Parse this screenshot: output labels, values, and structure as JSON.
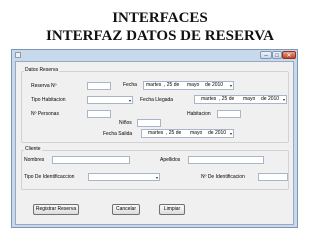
{
  "slide": {
    "title": "INTERFACES",
    "subtitle": "INTERFAZ DATOS DE RESERVA"
  },
  "window": {
    "controls": {
      "minimize": "–",
      "maximize": "□",
      "close": "✕"
    }
  },
  "reserva": {
    "group_label": "Datos Reserva",
    "reserva_no_label": "Reserva Nº",
    "fecha_label": "Fecha",
    "fecha": {
      "day_name": "martes",
      "day": ", 25 de",
      "month": "mayo",
      "year": "de 2010"
    },
    "tipo_habitacion_label": "Tipo Habitacion",
    "fecha_llegada_label": "Fecha Llegada",
    "fecha_llegada": {
      "day_name": "martes",
      "day": ", 25 de",
      "month": "mayo",
      "year": "de 2010"
    },
    "personas_label": "Nº Personas",
    "habitacion_label": "Habitacion",
    "ninos_label": "Niños",
    "fecha_salida_label": "Fecha Salida",
    "fecha_salida": {
      "day_name": "martes",
      "day": ", 25 de",
      "month": "mayo",
      "year": "de 2010"
    }
  },
  "cliente": {
    "group_label": "Cliente",
    "nombres_label": "Nombres",
    "apellidos_label": "Apellidos",
    "tipo_id_label": "Tipo De Identificaccion",
    "no_id_label": "Nº De Identificacion"
  },
  "buttons": {
    "registrar": "Registrar Reserva",
    "cancelar": "Cancelar",
    "limpiar": "Limpiar"
  },
  "icons": {
    "dropdown": "▾"
  },
  "colors": {
    "window_frame": "#c9d9ec",
    "client": "#f0f0f0",
    "close": "#c2432b"
  }
}
